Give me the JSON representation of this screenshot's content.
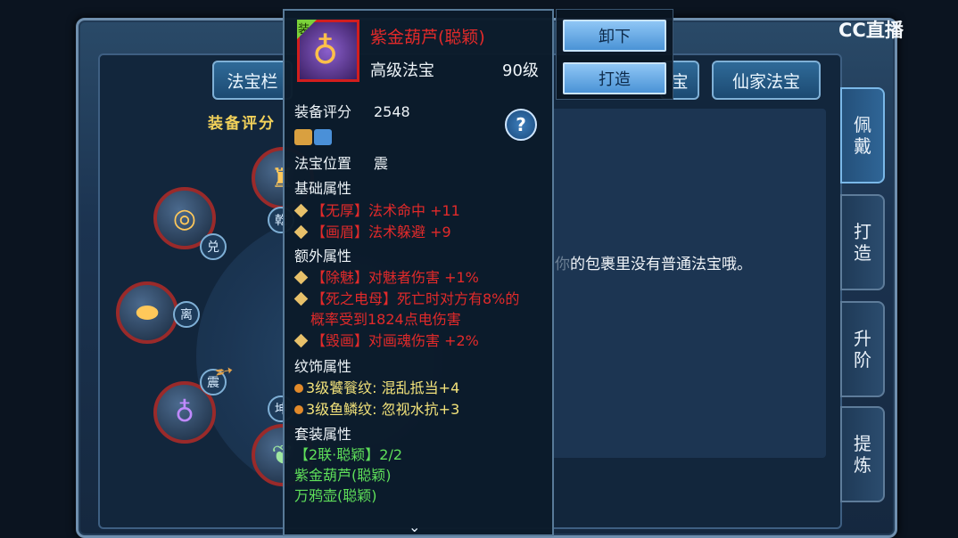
{
  "top_tabs": {
    "fabao_tab": "法宝栏",
    "partial_tab": "宝",
    "xianjia_tab": "仙家法宝"
  },
  "side_tabs": [
    "佩\n戴",
    "打\n造",
    "升\n阶",
    "提\n炼"
  ],
  "score_label": "装备评分",
  "empty_message": {
    "faded": "你",
    "text": "的包裹里没有普通法宝哦。"
  },
  "trigrams": {
    "qian": "乾",
    "dui": "兑",
    "li": "离",
    "zhen": "震",
    "kun": "坤"
  },
  "tooltip": {
    "badge": "装",
    "name": "紫金葫芦(聪颖)",
    "grade": "高级法宝",
    "level": "90级",
    "score_label": "装备评分",
    "score": "2548",
    "position_label": "法宝位置",
    "position_value": "震",
    "base_header": "基础属性",
    "base_attrs": [
      "【无厚】法术命中 +11",
      "【画眉】法术躲避 +9"
    ],
    "extra_header": "额外属性",
    "extra_attrs": [
      "【除魅】对魅者伤害 +1%",
      "【死之电母】死亡时对方有8%的",
      "概率受到1824点电伤害",
      "【毁画】对画魂伤害 +2%"
    ],
    "pattern_header": "纹饰属性",
    "pattern_attrs": [
      "3级饕餮纹: 混乱抵当+4",
      "3级鱼鳞纹: 忽视水抗+3"
    ],
    "set_header": "套装属性",
    "set_name": "【2联·聪颖】2/2",
    "set_items": [
      "紫金葫芦(聪颖)",
      "万鸦壶(聪颖)"
    ]
  },
  "buttons": {
    "unequip": "卸下",
    "forge": "打造"
  },
  "help": "?",
  "logo": "CC直播"
}
